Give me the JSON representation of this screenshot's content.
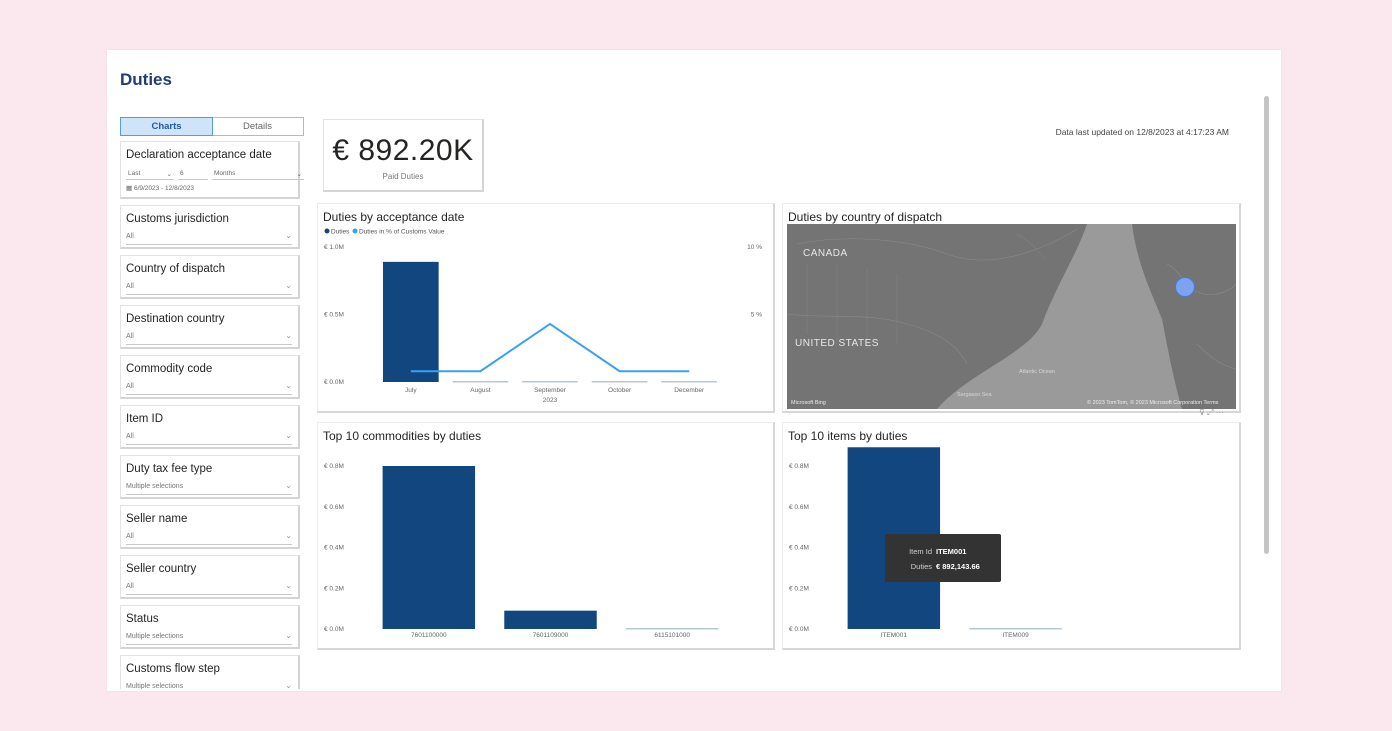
{
  "page": {
    "title": "Duties",
    "last_updated": "Data last updated on 12/8/2023 at 4:17:23 AM"
  },
  "tabs": [
    {
      "label": "Charts",
      "active": true
    },
    {
      "label": "Details",
      "active": false
    }
  ],
  "filters": {
    "date": {
      "title": "Declaration acceptance date",
      "period": "Last",
      "count": "6",
      "unit": "Months",
      "range": "6/9/2023 - 12/8/2023"
    },
    "items": [
      {
        "title": "Customs jurisdiction",
        "value": "All"
      },
      {
        "title": "Country of dispatch",
        "value": "All"
      },
      {
        "title": "Destination country",
        "value": "All"
      },
      {
        "title": "Commodity code",
        "value": "All"
      },
      {
        "title": "Item ID",
        "value": "All"
      },
      {
        "title": "Duty tax fee type",
        "value": "Multiple selections"
      },
      {
        "title": "Seller name",
        "value": "All"
      },
      {
        "title": "Seller country",
        "value": "All"
      },
      {
        "title": "Status",
        "value": "Multiple selections"
      },
      {
        "title": "Customs flow step",
        "value": "Multiple selections"
      }
    ]
  },
  "kpi": {
    "value": "€ 892.20K",
    "label": "Paid Duties"
  },
  "map": {
    "title": "Duties by country of dispatch",
    "labels": {
      "canada": "CANADA",
      "us": "UNITED STATES",
      "ocean": "Atlantic Ocean",
      "sea": "Sargasso Sea"
    },
    "attribution": "© 2023 TomTom, © 2023 Microsoft Corporation  Terms",
    "bubble_color": "#7da2f0"
  },
  "colors": {
    "bar": "#12467f",
    "line": "#3aa0f5",
    "text": "#252423"
  },
  "chart_data": [
    {
      "type": "bar",
      "title": "Duties by acceptance date",
      "legend": [
        "Duties",
        "Duties in % of Customs Value"
      ],
      "categories": [
        "July",
        "August",
        "September",
        "October",
        "December"
      ],
      "xlabel_sub": "2023",
      "series": [
        {
          "name": "Duties",
          "type": "bar",
          "values": [
            0.89,
            0.0,
            0.0,
            0.0,
            0.0
          ]
        },
        {
          "name": "Duties in % of Customs Value",
          "type": "line",
          "values": [
            0.8,
            0.8,
            4.3,
            0.8,
            0.8
          ]
        }
      ],
      "ylim": [
        0,
        1.0
      ],
      "y_ticks": [
        "€ 0.0M",
        "€ 0.5M",
        "€ 1.0M"
      ],
      "y2lim": [
        0,
        10
      ],
      "y2_ticks": [
        "5 %",
        "10 %"
      ]
    },
    {
      "type": "bar",
      "title": "Top 10 commodities by duties",
      "categories": [
        "7601100000",
        "7601109000",
        "6115101000"
      ],
      "values": [
        0.8,
        0.09,
        0.0
      ],
      "ylim": [
        0,
        0.8
      ],
      "y_ticks": [
        "€ 0.0M",
        "€ 0.2M",
        "€ 0.4M",
        "€ 0.6M",
        "€ 0.8M"
      ]
    },
    {
      "type": "bar",
      "title": "Top 10 items by duties",
      "categories": [
        "ITEM001",
        "ITEM009"
      ],
      "values": [
        0.892,
        0.0
      ],
      "ylim": [
        0,
        0.8
      ],
      "y_ticks": [
        "€ 0.0M",
        "€ 0.2M",
        "€ 0.4M",
        "€ 0.6M",
        "€ 0.8M"
      ],
      "tooltip": {
        "id_label": "Item Id",
        "id_value": "ITEM001",
        "duties_label": "Duties",
        "duties_value": "€ 892,143.66"
      }
    }
  ]
}
